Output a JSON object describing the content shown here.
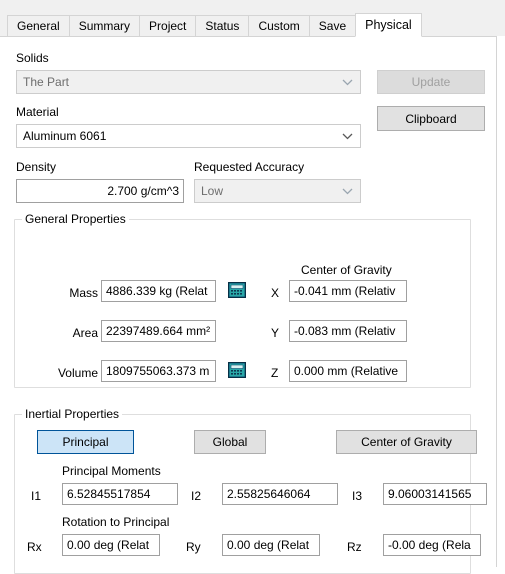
{
  "tabs": [
    {
      "label": "General",
      "active": false
    },
    {
      "label": "Summary",
      "active": false
    },
    {
      "label": "Project",
      "active": false
    },
    {
      "label": "Status",
      "active": false
    },
    {
      "label": "Custom",
      "active": false
    },
    {
      "label": "Save",
      "active": false
    },
    {
      "label": "Physical",
      "active": true
    }
  ],
  "solids": {
    "label": "Solids",
    "value": "The Part"
  },
  "material": {
    "label": "Material",
    "value": "Aluminum 6061"
  },
  "density": {
    "label": "Density",
    "value": "2.700 g/cm^3"
  },
  "accuracy": {
    "label": "Requested Accuracy",
    "value": "Low"
  },
  "actions": {
    "update_label": "Update",
    "clipboard_label": "Clipboard"
  },
  "general_properties": {
    "title": "General Properties",
    "cog_title": "Center of Gravity",
    "rows": [
      {
        "label": "Mass",
        "value": "4886.339 kg (Relat",
        "has_calc": true
      },
      {
        "label": "Area",
        "value": "22397489.664 mm²",
        "has_calc": false
      },
      {
        "label": "Volume",
        "value": "1809755063.373 m",
        "has_calc": true
      }
    ],
    "cog": [
      {
        "label": "X",
        "value": "-0.041 mm (Relativ"
      },
      {
        "label": "Y",
        "value": "-0.083 mm (Relativ"
      },
      {
        "label": "Z",
        "value": "0.000 mm (Relative"
      }
    ]
  },
  "inertial_properties": {
    "title": "Inertial Properties",
    "buttons": [
      {
        "label": "Principal",
        "selected": true
      },
      {
        "label": "Global",
        "selected": false
      },
      {
        "label": "Center of Gravity",
        "selected": false
      }
    ],
    "moments_heading": "Principal Moments",
    "moments": [
      {
        "label": "I1",
        "value": "6.52845517854"
      },
      {
        "label": "I2",
        "value": "2.55825646064"
      },
      {
        "label": "I3",
        "value": "9.06003141565"
      }
    ],
    "rotation_heading": "Rotation to Principal",
    "rotations": [
      {
        "label": "Rx",
        "value": "0.00 deg (Relat"
      },
      {
        "label": "Ry",
        "value": "0.00 deg (Relat"
      },
      {
        "label": "Rz",
        "value": "-0.00 deg (Rela"
      }
    ]
  },
  "colors": {
    "accent": "#cce4f7",
    "accent_border": "#005499",
    "icon_teal": "#1a8c8c",
    "panel_bg": "#f0f0f0"
  }
}
